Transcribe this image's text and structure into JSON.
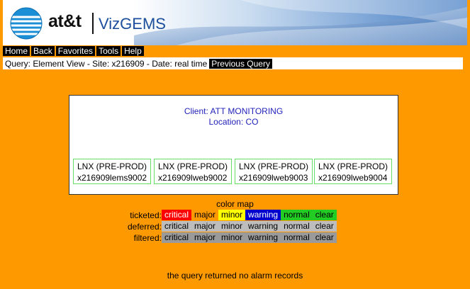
{
  "brand": {
    "att": "at&t",
    "product": "VizGEMS"
  },
  "menu": [
    "Home",
    "Back",
    "Favorites",
    "Tools",
    "Help"
  ],
  "query": {
    "text": "Query: Element View - Site: x216909 - Date: real time",
    "previous_label": "Previous Query"
  },
  "panel": {
    "client": "Client: ATT MONITORING",
    "location": "Location: CO",
    "elements": [
      {
        "type": "LNX (PRE-PROD)",
        "name": "x216909lems9002"
      },
      {
        "type": "LNX (PRE-PROD)",
        "name": "x216909lweb9002"
      },
      {
        "type": "LNX (PRE-PROD)",
        "name": "x216909lweb9003"
      },
      {
        "type": "LNX (PRE-PROD)",
        "name": "x216909lweb9004"
      }
    ]
  },
  "color_map": {
    "title": "color map",
    "levels": [
      "critical",
      "major",
      "minor",
      "warning",
      "normal",
      "clear"
    ],
    "rows": [
      {
        "label": "ticketed:"
      },
      {
        "label": "deferred:"
      },
      {
        "label": "filtered:"
      }
    ],
    "colors": {
      "critical": "#ff0000",
      "major": "#ff9900",
      "minor": "#ffff00",
      "warning": "#0000cc",
      "normal": "#22cc22",
      "clear": "#22cc22",
      "deferred": "#bdbdbd",
      "filtered": "#9a9a9a"
    }
  },
  "status": "the query returned no alarm records",
  "page_background": "#ff9900"
}
